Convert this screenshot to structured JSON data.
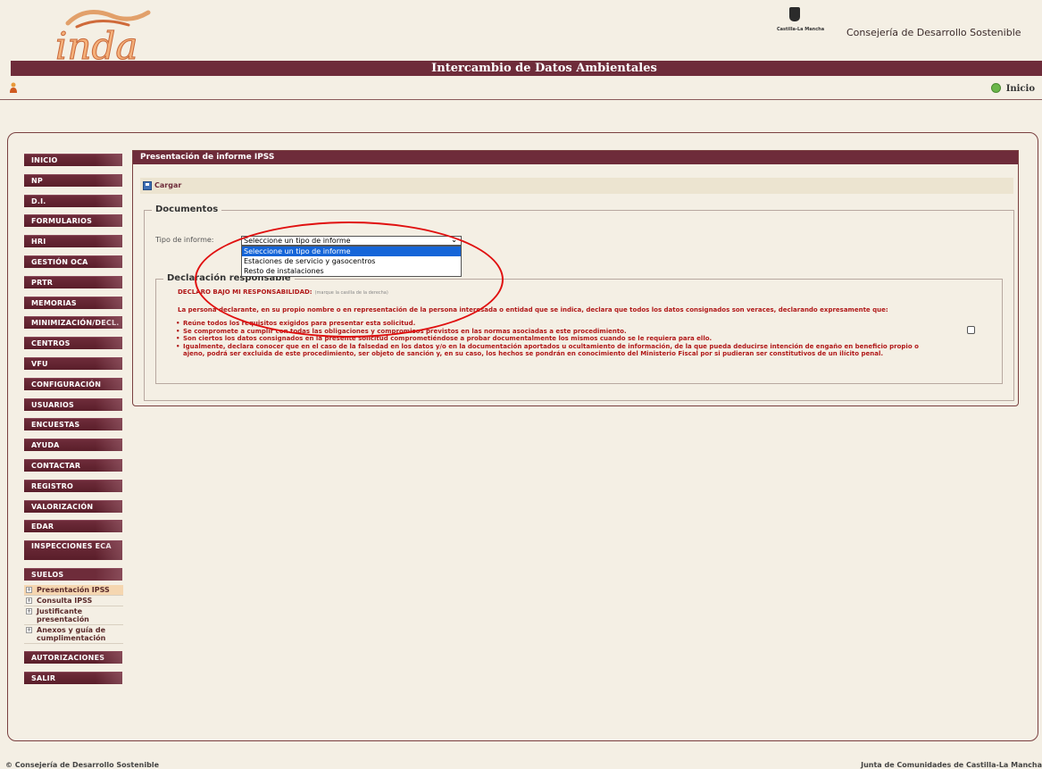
{
  "header": {
    "logo_text": "inda",
    "jccm_logo_text": "Castilla-La Mancha",
    "consejeria": "Consejería de Desarrollo Sostenible",
    "title": "Intercambio de Datos Ambientales",
    "inicio_label": "Inicio"
  },
  "sidebar": {
    "items": [
      {
        "label": "INICIO"
      },
      {
        "label": "NP"
      },
      {
        "label": "D.I."
      },
      {
        "label": "FORMULARIOS"
      },
      {
        "label": "HRI"
      },
      {
        "label": "GESTIÓN OCA"
      },
      {
        "label": "PRTR"
      },
      {
        "label": "MEMORIAS"
      },
      {
        "label": "MINIMIZACIÓN/DECL."
      },
      {
        "label": "CENTROS"
      },
      {
        "label": "VFU"
      },
      {
        "label": "CONFIGURACIÓN"
      },
      {
        "label": "USUARIOS"
      },
      {
        "label": "ENCUESTAS"
      },
      {
        "label": "AYUDA"
      },
      {
        "label": "CONTACTAR"
      },
      {
        "label": "REGISTRO"
      },
      {
        "label": "VALORIZACIÓN"
      },
      {
        "label": "EDAR"
      },
      {
        "label": "INSPECCIONES ECA"
      },
      {
        "label": "SUELOS"
      }
    ],
    "suelos_sub": [
      {
        "label": "Presentación IPSS",
        "active": true
      },
      {
        "label": "Consulta IPSS"
      },
      {
        "label": "Justificante presentación"
      },
      {
        "label": "Anexos y guía de cumplimentación"
      }
    ],
    "items_after": [
      {
        "label": "AUTORIZACIONES"
      },
      {
        "label": "SALIR"
      }
    ]
  },
  "content": {
    "title": "Presentación de informe IPSS",
    "toolbar_cargar": "Cargar",
    "docs_legend": "Documentos",
    "tipo_label": "Tipo de informe:",
    "tipo_selected": "Seleccione un tipo de informe",
    "tipo_options": [
      "Seleccione un tipo de informe",
      "Estaciones de servicio y gasocentros",
      "Resto de instalaciones"
    ],
    "decl_legend": "Declaración responsable",
    "decl_title": "DECLARO BAJO MI RESPONSABILIDAD:",
    "decl_title_small": "(marque la casilla de la derecha)",
    "decl_intro": "La persona declarante, en su propio nombre o en representación de la persona interesada o entidad que se indica, declara que todos los datos consignados son veraces, declarando expresamente que:",
    "decl_items": [
      "Reúne todos los requisitos exigidos para presentar esta solicitud.",
      "Se compromete a cumplir con todas las obligaciones y compromisos previstos en las normas asociadas a este procedimiento.",
      "Son ciertos los datos consignados en la presente solicitud comprometiéndose a probar documentalmente los mismos cuando se le requiera para ello.",
      "Igualmente, declara conocer que en el caso de la falsedad en los datos y/o en la documentación aportados u ocultamiento de información, de la que pueda deducirse intención de engaño en beneficio propio o ajeno, podrá ser excluida de este procedimiento, ser objeto de sanción y, en su caso, los hechos se pondrán en conocimiento del Ministerio Fiscal por si pudieran ser constitutivos de un ilícito penal."
    ]
  },
  "footer": {
    "left": "© Consejería de Desarrollo Sostenible",
    "right": "Junta de Comunidades de Castilla-La Mancha"
  },
  "colors": {
    "brand": "#6e2c3a",
    "background": "#f4efe4",
    "declaration_text": "#b01818",
    "annotation": "#e01010",
    "select_highlight": "#1565d8"
  }
}
